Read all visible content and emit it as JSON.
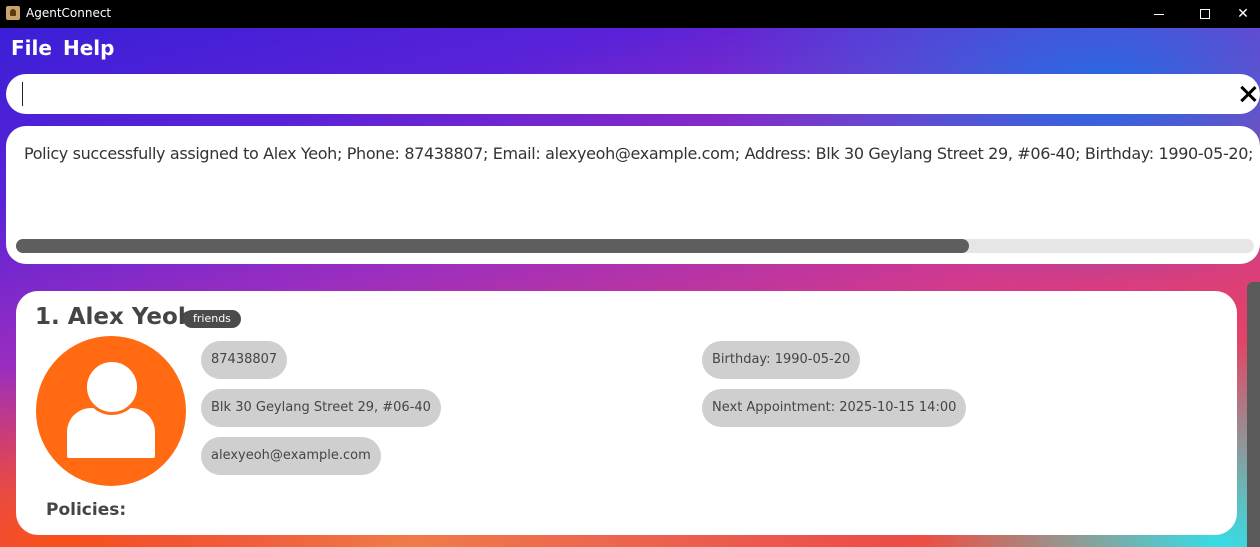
{
  "window": {
    "title": "AgentConnect"
  },
  "menu": {
    "file": "File",
    "help": "Help"
  },
  "command_box": {
    "value": ""
  },
  "result": {
    "text": "Policy successfully assigned to Alex Yeoh; Phone: 87438807; Email: alexyeoh@example.com; Address: Blk 30 Geylang Street 29, #06-40; Birthday: 1990-05-20;",
    "scroll_fraction": 0.77
  },
  "person": {
    "name": "1. Alex Yeoh",
    "tag": "friends",
    "phone": "87438807",
    "address": "Blk 30 Geylang Street 29, #06-40",
    "email": "alexyeoh@example.com",
    "birthday": "Birthday: 1990-05-20",
    "appointment": "Next Appointment: 2025-10-15 14:00",
    "policies_label": "Policies:"
  },
  "colors": {
    "avatar": "#ff6a12",
    "tag_bg": "#4b4b4b",
    "pill_bg": "#cfcfcf"
  }
}
